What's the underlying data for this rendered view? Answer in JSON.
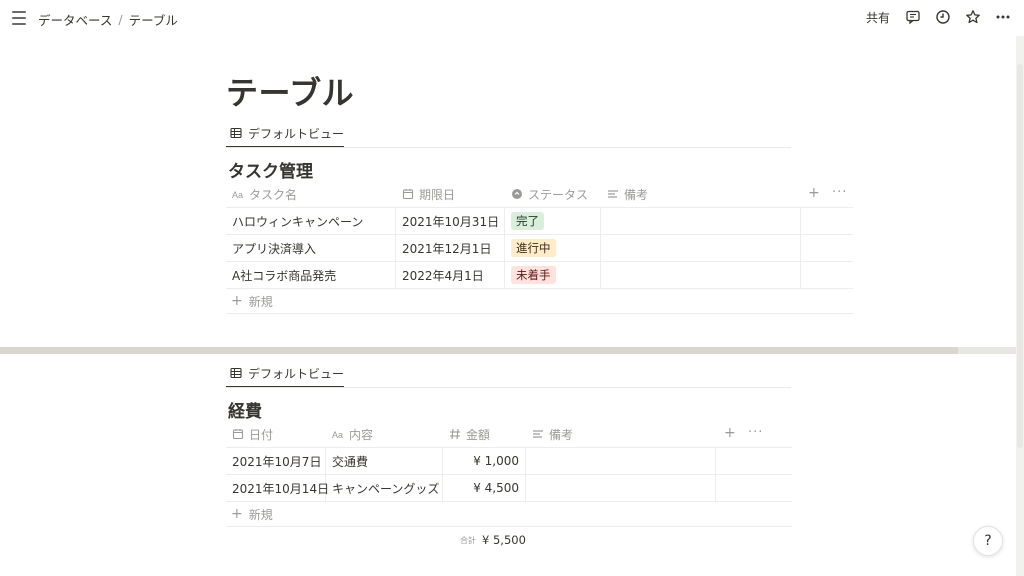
{
  "topbar": {
    "breadcrumb": [
      "データベース",
      "テーブル"
    ],
    "separator": "/",
    "share_label": "共有",
    "icons": [
      "comment-icon",
      "clock-icon",
      "star-icon",
      "more-icon"
    ]
  },
  "page": {
    "title": "テーブル"
  },
  "db1": {
    "view_label": "デフォルトビュー",
    "title": "タスク管理",
    "headers": {
      "name": "タスク名",
      "due": "期限日",
      "status": "ステータス",
      "note": "備考"
    },
    "rows": [
      {
        "name": "ハロウィンキャンペーン",
        "due": "2021年10月31日",
        "status": "完了",
        "note": ""
      },
      {
        "name": "アプリ決済導入",
        "due": "2021年12月1日",
        "status": "進行中",
        "note": ""
      },
      {
        "name": "A社コラボ商品発売",
        "due": "2022年4月1日",
        "status": "未着手",
        "note": ""
      }
    ],
    "status_colors": {
      "完了": {
        "bg": "#dbeddb",
        "fg": "#1c3829"
      },
      "進行中": {
        "bg": "#fdecc8",
        "fg": "#402c1b"
      },
      "未着手": {
        "bg": "#ffe2dd",
        "fg": "#5d1715"
      }
    },
    "new_label": "新規"
  },
  "db2": {
    "view_label": "デフォルトビュー",
    "title": "経費",
    "headers": {
      "date": "日付",
      "content": "内容",
      "amount": "金額",
      "note": "備考"
    },
    "rows": [
      {
        "date": "2021年10月7日",
        "content": "交通費",
        "amount": "¥ 1,000",
        "note": ""
      },
      {
        "date": "2021年10月14日",
        "content": "キャンペーングッズ",
        "amount": "¥ 4,500",
        "note": ""
      }
    ],
    "new_label": "新規",
    "sum_label": "合計",
    "sum_value": "¥ 5,500"
  },
  "help": {
    "label": "?"
  }
}
